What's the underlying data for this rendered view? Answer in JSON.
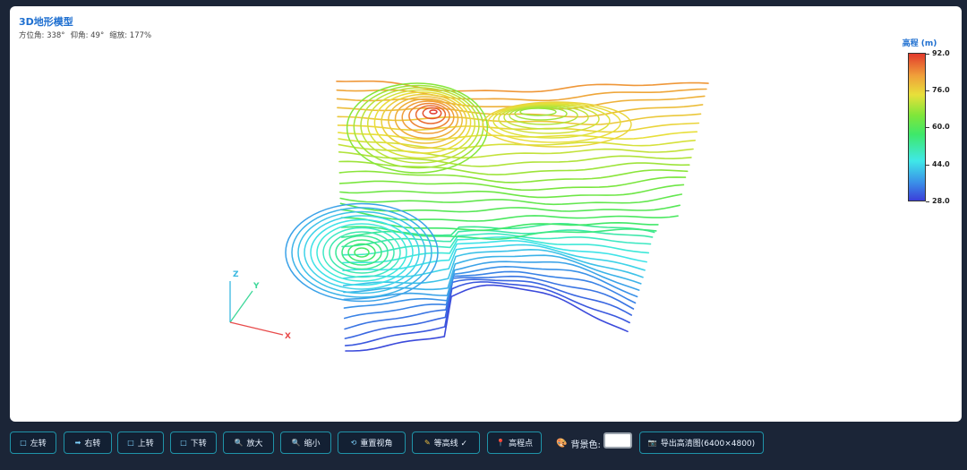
{
  "title": "3D地形模型",
  "view": {
    "azimuth_label": "方位角:",
    "azimuth": "338°",
    "elevation_label": "仰角:",
    "elevation": "49°",
    "zoom_label": "缩放:",
    "zoom": "177%"
  },
  "legend": {
    "title": "高程 (m)",
    "ticks": [
      "92.0",
      "76.0",
      "60.0",
      "44.0",
      "28.0"
    ],
    "colors": [
      "#e23a2c",
      "#f0a03a",
      "#e8e03a",
      "#7fe63a",
      "#3ee86a",
      "#3fe8e8",
      "#3a8ee8",
      "#3b3fd9"
    ]
  },
  "axes": {
    "x": "X",
    "y": "Y",
    "z": "Z"
  },
  "toolbar": {
    "rotate_left": {
      "label": "左转",
      "icon": "square-icon"
    },
    "rotate_right": {
      "label": "右转",
      "icon": "arrow-right-icon"
    },
    "rotate_up": {
      "label": "上转",
      "icon": "square-icon"
    },
    "rotate_down": {
      "label": "下转",
      "icon": "square-icon"
    },
    "zoom_in": {
      "label": "放大",
      "icon": "magnifier-icon"
    },
    "zoom_out": {
      "label": "缩小",
      "icon": "magnifier-icon"
    },
    "reset_view": {
      "label": "重置视角",
      "icon": "reset-icon"
    },
    "contours": {
      "label": "等高线 ✓",
      "icon": "pencil-icon"
    },
    "elevation_points": {
      "label": "高程点",
      "icon": "pin-icon"
    },
    "background_label": "背景色:",
    "background_color": "#ffffff",
    "export": {
      "label": "导出高清图(6400×4800)",
      "icon": "camera-icon"
    }
  }
}
